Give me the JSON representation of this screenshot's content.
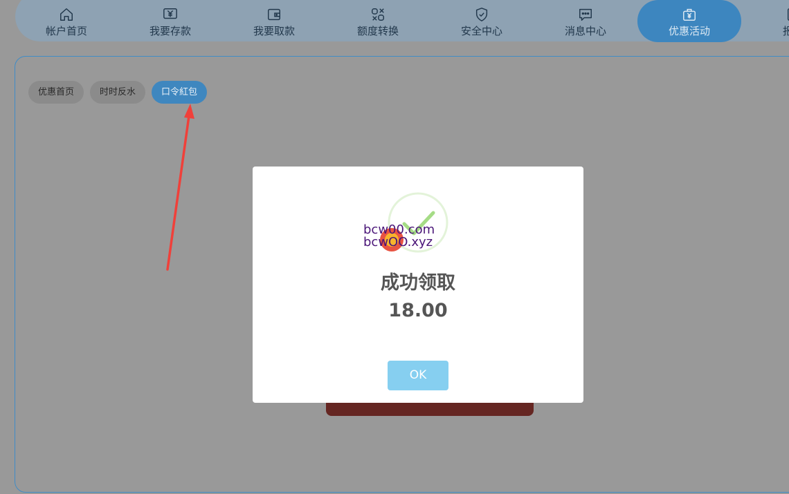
{
  "nav": {
    "items": [
      {
        "label": "帐户首页",
        "icon": "home-icon"
      },
      {
        "label": "我要存款",
        "icon": "yen-deposit-icon"
      },
      {
        "label": "我要取款",
        "icon": "wallet-icon"
      },
      {
        "label": "额度转换",
        "icon": "transfer-icon"
      },
      {
        "label": "安全中心",
        "icon": "shield-icon"
      },
      {
        "label": "消息中心",
        "icon": "message-icon"
      },
      {
        "label": "优惠活动",
        "icon": "gift-icon",
        "active": true
      },
      {
        "label": "报表",
        "icon": "report-icon"
      }
    ]
  },
  "subtabs": [
    {
      "label": "优惠首页"
    },
    {
      "label": "时时反水"
    },
    {
      "label": "口令紅包",
      "active": true
    }
  ],
  "modal": {
    "title": "成功领取",
    "amount": "18.00",
    "ok_label": "OK",
    "icon": "success-check-icon"
  },
  "watermark": {
    "line1": "bcw00.com",
    "line2": "bcwOO.xyz"
  },
  "colors": {
    "accent": "#3d86bf",
    "ok_button": "#86cff0",
    "annotation_arrow": "#f0403a",
    "check_green": "#a5dc86"
  }
}
